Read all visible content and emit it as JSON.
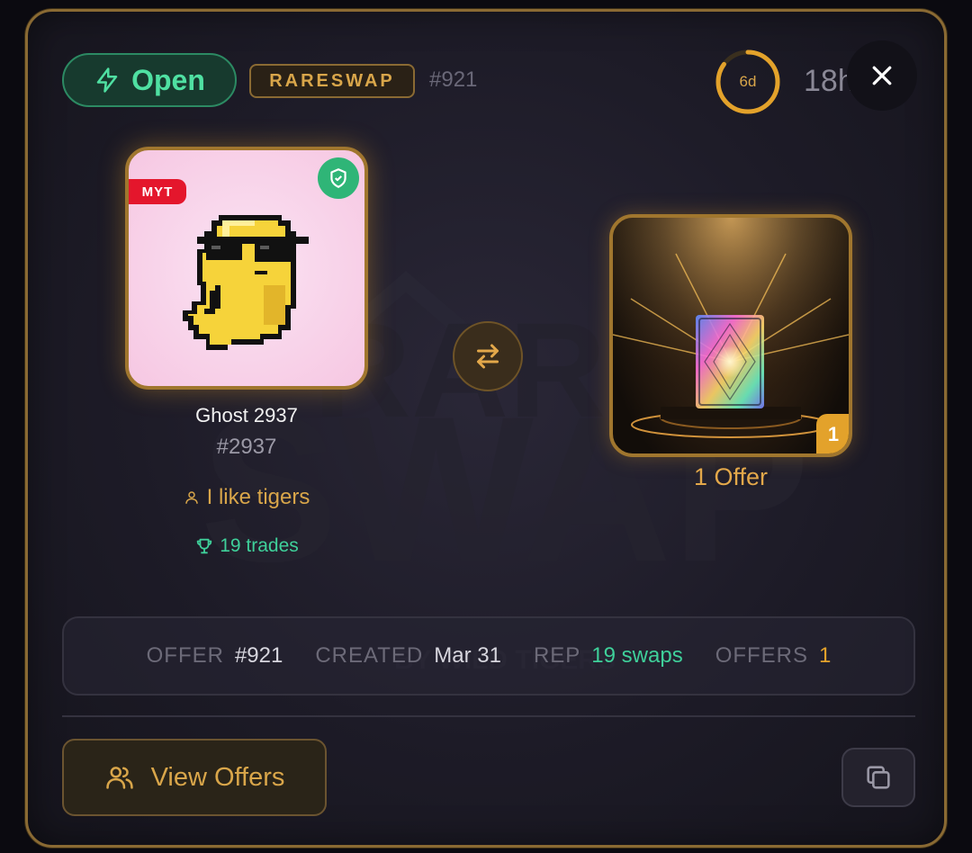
{
  "header": {
    "status_label": "Open",
    "brand": "RARESWAP",
    "offer_ref": "#921",
    "timer_label": "6d",
    "timer_progress": 0.85,
    "time_ago": "18h ago"
  },
  "nft": {
    "chain_tag": "MYT",
    "verified": true,
    "name": "Ghost 2937",
    "number": "#2937",
    "owner": "I like tigers",
    "trades": "19 trades"
  },
  "offer": {
    "count_badge": "1",
    "label": "1 Offer"
  },
  "details": {
    "offer_key": "OFFER",
    "offer_val": "#921",
    "created_key": "CREATED",
    "created_val": "Mar 31",
    "rep_key": "REP",
    "rep_val": "19 swaps",
    "offers_key": "OFFERS",
    "offers_val": "1"
  },
  "actions": {
    "view_offers": "View Offers"
  },
  "icons": [
    "bolt-icon",
    "close-icon",
    "shield-check-icon",
    "user-icon",
    "trophy-icon",
    "swap-arrows-icon",
    "users-icon",
    "copy-icon"
  ],
  "colors": {
    "accent_gold": "#d9a64a",
    "status_green": "#4fe0a2",
    "chain_red": "#e4162c"
  }
}
